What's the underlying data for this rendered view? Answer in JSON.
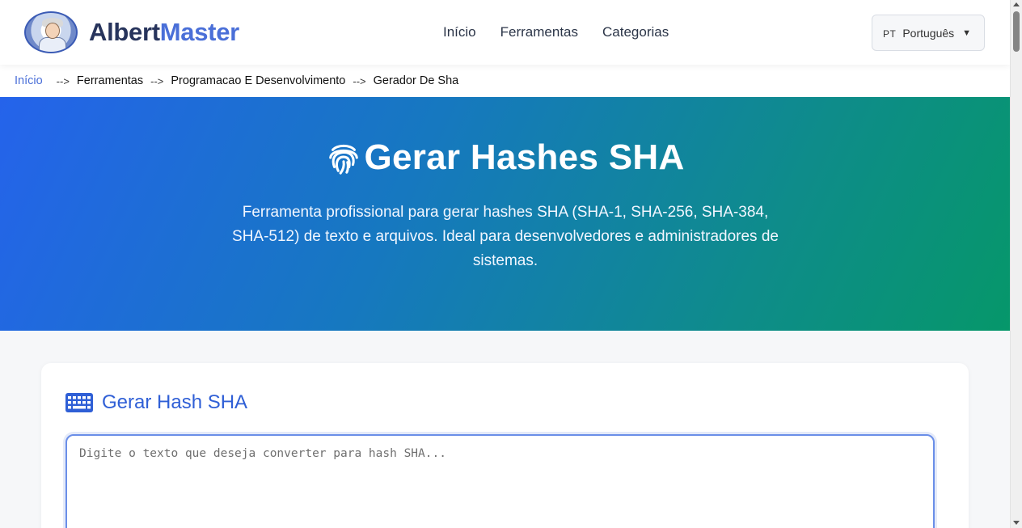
{
  "header": {
    "logo_part1": "Albert",
    "logo_part2": "Master",
    "nav": [
      "Início",
      "Ferramentas",
      "Categorias"
    ],
    "language": {
      "code": "PT",
      "label": "Português",
      "caret": "▼"
    }
  },
  "breadcrumb": {
    "home": "Início",
    "separator": "-->",
    "items": [
      "Ferramentas",
      "Programacao E Desenvolvimento",
      "Gerador De Sha"
    ]
  },
  "hero": {
    "icon": "fingerprint-icon",
    "title": "Gerar Hashes SHA",
    "description": "Ferramenta profissional para gerar hashes SHA (SHA-1, SHA-256, SHA-384, SHA-512) de texto e arquivos. Ideal para desenvolvedores e administradores de sistemas."
  },
  "card": {
    "icon": "keyboard-icon",
    "title": "Gerar Hash SHA",
    "input_value": "",
    "input_placeholder": "Digite o texto que deseja converter para hash SHA..."
  },
  "colors": {
    "brand_dark": "#27345c",
    "brand_accent": "#4a6fd8",
    "hero_gradient_start": "#2563eb",
    "hero_gradient_end": "#06976a"
  }
}
